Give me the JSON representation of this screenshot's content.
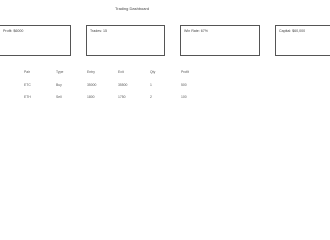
{
  "header": {
    "title": "Trading Dashboard"
  },
  "cards": [
    {
      "label": "Profit: $6000"
    },
    {
      "label": "Trades: 15"
    },
    {
      "label": "Win Rate: 67%"
    },
    {
      "label": "Capital: $60,000"
    }
  ],
  "trades_table": {
    "columns": [
      "Pair",
      "Type",
      "Entry",
      "Exit",
      "Qty",
      "Profit"
    ],
    "rows": [
      [
        "ETC",
        "Buy",
        "35000",
        "35500",
        "1",
        "500"
      ],
      [
        "ETH",
        "Sell",
        "1800",
        "1750",
        "2",
        "100"
      ]
    ]
  }
}
